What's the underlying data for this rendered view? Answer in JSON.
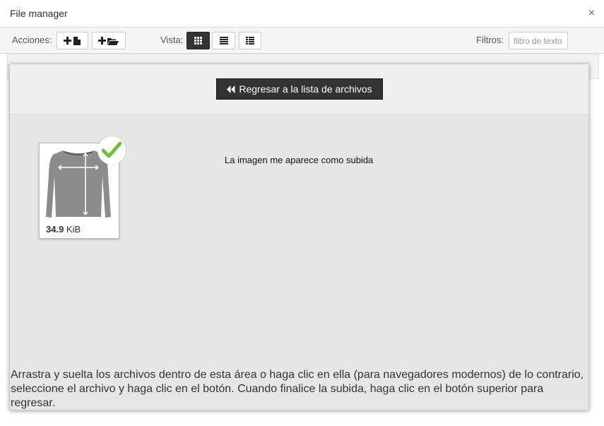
{
  "window": {
    "title": "File manager",
    "close_glyph": "×"
  },
  "toolbar": {
    "actions_label": "Acciones:",
    "upload_file_icon": "add-file-icon",
    "new_folder_icon": "add-folder-icon",
    "view_label": "Vista:",
    "views": [
      {
        "name": "grid",
        "icon": "grid-view-icon",
        "active": true
      },
      {
        "name": "list",
        "icon": "list-view-icon",
        "active": false
      },
      {
        "name": "details",
        "icon": "details-view-icon",
        "active": false
      }
    ],
    "filter_label": "Filtros:",
    "filter_placeholder": "filtro de texto",
    "filter_value": ""
  },
  "dropzone": {
    "back_button_icon": "double-chevron-left-icon",
    "back_button_label": "Regresar a la lista de archivos",
    "file": {
      "thumbnail_icon": "long-sleeve-shirt-image",
      "size_value": "34.9",
      "size_unit": "KiB",
      "status_icon": "checkmark-icon",
      "status_color": "#6fbf3a"
    },
    "note": "La imagen me aparece como subida",
    "help_text": "Arrastra y suelta los archivos dentro de esta área o haga clic en ella (para navegadores modernos) de lo contrario, seleccione el archivo y haga clic en el botón. Cuando finalice la subida, haga clic en el botón superior para regresar."
  }
}
